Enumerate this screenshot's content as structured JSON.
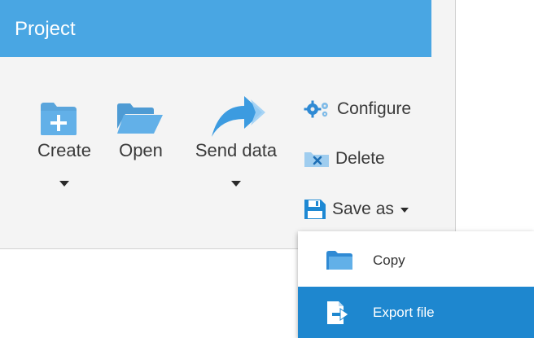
{
  "panel": {
    "title": "Project",
    "accent_color": "#49a6e3"
  },
  "toolbar": {
    "create": {
      "label": "Create",
      "icon": "folder-plus-icon",
      "has_dropdown": true
    },
    "open": {
      "label": "Open",
      "icon": "folder-open-icon",
      "has_dropdown": false
    },
    "send_data": {
      "label": "Send data",
      "icon": "share-arrow-icon",
      "has_dropdown": true
    }
  },
  "side_actions": {
    "configure": {
      "label": "Configure",
      "icon": "gears-icon"
    },
    "delete": {
      "label": "Delete",
      "icon": "delete-x-icon"
    },
    "save_as": {
      "label": "Save as",
      "icon": "floppy-disk-icon",
      "has_dropdown": true
    }
  },
  "save_as_menu": {
    "items": [
      {
        "label": "Copy",
        "icon": "folder-icon",
        "active": false
      },
      {
        "label": "Export file",
        "icon": "export-file-icon",
        "active": true
      }
    ],
    "active_color": "#1e87cf"
  }
}
